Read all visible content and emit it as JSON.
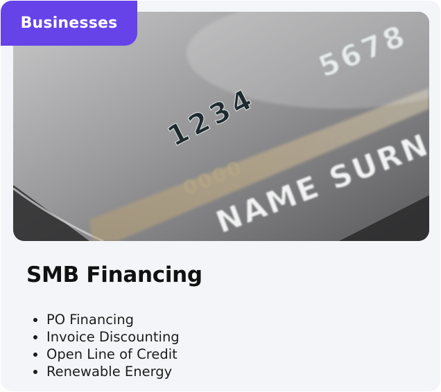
{
  "badge": {
    "label": "Businesses"
  },
  "image": {
    "card_number": "1234",
    "card_number_end": "5678",
    "card_faint_digits": "0000",
    "cardholder": "NAME SURNAME"
  },
  "title": "SMB Financing",
  "features": [
    "PO Financing",
    "Invoice Discounting",
    "Open Line of Credit",
    "Renewable Energy"
  ],
  "colors": {
    "badge_bg": "#6543e8",
    "card_bg": "#f4f5f8",
    "title": "#111111",
    "text": "#1c1c1c"
  }
}
